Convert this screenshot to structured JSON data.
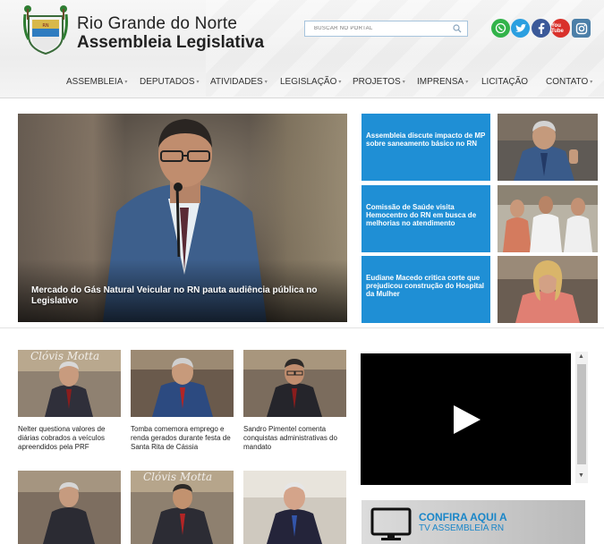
{
  "header": {
    "title_line1": "Rio Grande do Norte",
    "title_line2": "Assembleia Legislativa",
    "search_placeholder": "BUSCAR NO PORTAL",
    "social": [
      "whatsapp-icon",
      "twitter-icon",
      "facebook-icon",
      "youtube-icon",
      "instagram-icon"
    ],
    "youtube_label": "You Tube"
  },
  "nav": {
    "items": [
      {
        "label": "ASSEMBLEIA",
        "has_submenu": true
      },
      {
        "label": "DEPUTADOS",
        "has_submenu": true
      },
      {
        "label": "ATIVIDADES",
        "has_submenu": true
      },
      {
        "label": "LEGISLAÇÃO",
        "has_submenu": true
      },
      {
        "label": "PROJETOS",
        "has_submenu": true
      },
      {
        "label": "IMPRENSA",
        "has_submenu": true
      },
      {
        "label": "LICITAÇÃO",
        "has_submenu": false
      },
      {
        "label": "CONTATO",
        "has_submenu": true
      }
    ]
  },
  "hero": {
    "caption": "Mercado do Gás Natural Veicular no RN pauta audiência pública no Legislativo"
  },
  "side_news": [
    {
      "title": "Assembleia discute impacto de MP sobre saneamento básico no RN"
    },
    {
      "title": "Comissão de Saúde visita Hemocentro do RN em busca de melhorias no atendimento"
    },
    {
      "title": "Eudiane Macedo critica corte que prejudicou construção do Hospital da Mulher"
    }
  ],
  "news": [
    {
      "title": "Nelter questiona valores de diárias cobrados a veículos apreendidos pela PRF",
      "watermark": "Clóvis Motta"
    },
    {
      "title": "Tomba comemora emprego e renda gerados durante festa de Santa Rita de Cássia",
      "watermark": ""
    },
    {
      "title": "Sandro Pimentel comenta conquistas administrativas do mandato",
      "watermark": ""
    },
    {
      "title": "",
      "watermark": ""
    },
    {
      "title": "",
      "watermark": "Clóvis Motta"
    },
    {
      "title": "",
      "watermark": ""
    }
  ],
  "tv_banner": {
    "line1": "CONFIRA AQUI A",
    "line2": "TV ASSEMBLEIA RN"
  },
  "colors": {
    "accent_blue": "#1f8fd5",
    "tv_text": "#1a86c8"
  }
}
